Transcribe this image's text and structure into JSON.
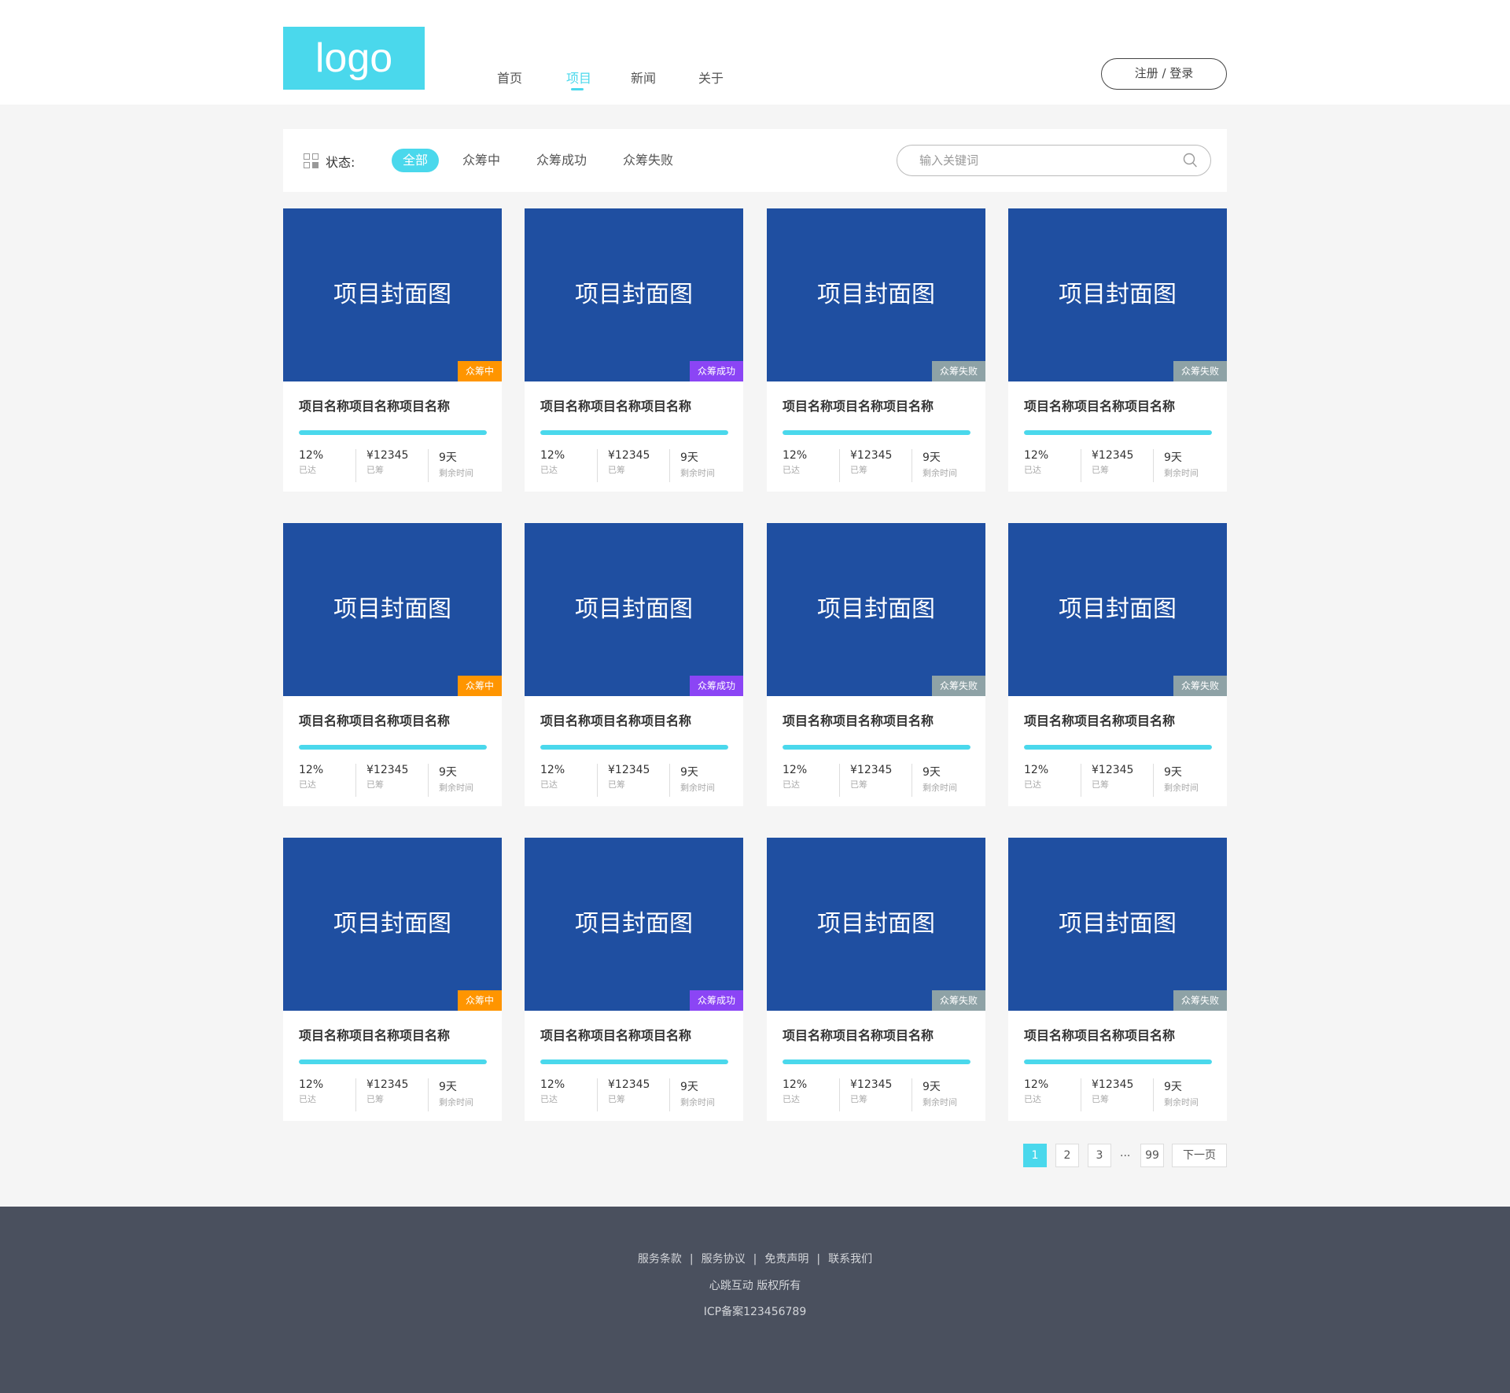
{
  "header": {
    "logo": "logo",
    "nav": [
      {
        "label": "首页",
        "active": false
      },
      {
        "label": "项目",
        "active": true
      },
      {
        "label": "新闻",
        "active": false
      },
      {
        "label": "关于",
        "active": false
      }
    ],
    "login": "注册 / 登录"
  },
  "filter": {
    "label": "状态:",
    "options": [
      {
        "label": "全部",
        "active": true
      },
      {
        "label": "众筹中",
        "active": false
      },
      {
        "label": "众筹成功",
        "active": false
      },
      {
        "label": "众筹失败",
        "active": false
      }
    ],
    "search_placeholder": "输入关键词"
  },
  "status_colors": {
    "众筹中": "#ff9500",
    "众筹成功": "#8b45f5",
    "众筹失败": "#8ea2a6"
  },
  "projects": [
    {
      "cover": "项目封面图",
      "badge": "众筹中",
      "title": "项目名称项目名称项目名称",
      "percent": "12%",
      "percent_label": "已达",
      "raised": "¥12345",
      "raised_label": "已筹",
      "days": "9天",
      "days_label": "剩余时间"
    },
    {
      "cover": "项目封面图",
      "badge": "众筹成功",
      "title": "项目名称项目名称项目名称",
      "percent": "12%",
      "percent_label": "已达",
      "raised": "¥12345",
      "raised_label": "已筹",
      "days": "9天",
      "days_label": "剩余时间"
    },
    {
      "cover": "项目封面图",
      "badge": "众筹失败",
      "title": "项目名称项目名称项目名称",
      "percent": "12%",
      "percent_label": "已达",
      "raised": "¥12345",
      "raised_label": "已筹",
      "days": "9天",
      "days_label": "剩余时间"
    },
    {
      "cover": "项目封面图",
      "badge": "众筹失败",
      "title": "项目名称项目名称项目名称",
      "percent": "12%",
      "percent_label": "已达",
      "raised": "¥12345",
      "raised_label": "已筹",
      "days": "9天",
      "days_label": "剩余时间"
    },
    {
      "cover": "项目封面图",
      "badge": "众筹中",
      "title": "项目名称项目名称项目名称",
      "percent": "12%",
      "percent_label": "已达",
      "raised": "¥12345",
      "raised_label": "已筹",
      "days": "9天",
      "days_label": "剩余时间"
    },
    {
      "cover": "项目封面图",
      "badge": "众筹成功",
      "title": "项目名称项目名称项目名称",
      "percent": "12%",
      "percent_label": "已达",
      "raised": "¥12345",
      "raised_label": "已筹",
      "days": "9天",
      "days_label": "剩余时间"
    },
    {
      "cover": "项目封面图",
      "badge": "众筹失败",
      "title": "项目名称项目名称项目名称",
      "percent": "12%",
      "percent_label": "已达",
      "raised": "¥12345",
      "raised_label": "已筹",
      "days": "9天",
      "days_label": "剩余时间"
    },
    {
      "cover": "项目封面图",
      "badge": "众筹失败",
      "title": "项目名称项目名称项目名称",
      "percent": "12%",
      "percent_label": "已达",
      "raised": "¥12345",
      "raised_label": "已筹",
      "days": "9天",
      "days_label": "剩余时间"
    },
    {
      "cover": "项目封面图",
      "badge": "众筹中",
      "title": "项目名称项目名称项目名称",
      "percent": "12%",
      "percent_label": "已达",
      "raised": "¥12345",
      "raised_label": "已筹",
      "days": "9天",
      "days_label": "剩余时间"
    },
    {
      "cover": "项目封面图",
      "badge": "众筹成功",
      "title": "项目名称项目名称项目名称",
      "percent": "12%",
      "percent_label": "已达",
      "raised": "¥12345",
      "raised_label": "已筹",
      "days": "9天",
      "days_label": "剩余时间"
    },
    {
      "cover": "项目封面图",
      "badge": "众筹失败",
      "title": "项目名称项目名称项目名称",
      "percent": "12%",
      "percent_label": "已达",
      "raised": "¥12345",
      "raised_label": "已筹",
      "days": "9天",
      "days_label": "剩余时间"
    },
    {
      "cover": "项目封面图",
      "badge": "众筹失败",
      "title": "项目名称项目名称项目名称",
      "percent": "12%",
      "percent_label": "已达",
      "raised": "¥12345",
      "raised_label": "已筹",
      "days": "9天",
      "days_label": "剩余时间"
    }
  ],
  "progress_fraction": 1.0,
  "pagination": {
    "pages": [
      "1",
      "2",
      "3"
    ],
    "ellipsis": "...",
    "last": "99",
    "next": "下一页",
    "active": "1"
  },
  "footer": {
    "links": [
      "服务条款",
      "服务协议",
      "免责声明",
      "联系我们"
    ],
    "link_sep": "|",
    "copyright": "心跳互动 版权所有",
    "icp": "ICP备案123456789"
  }
}
